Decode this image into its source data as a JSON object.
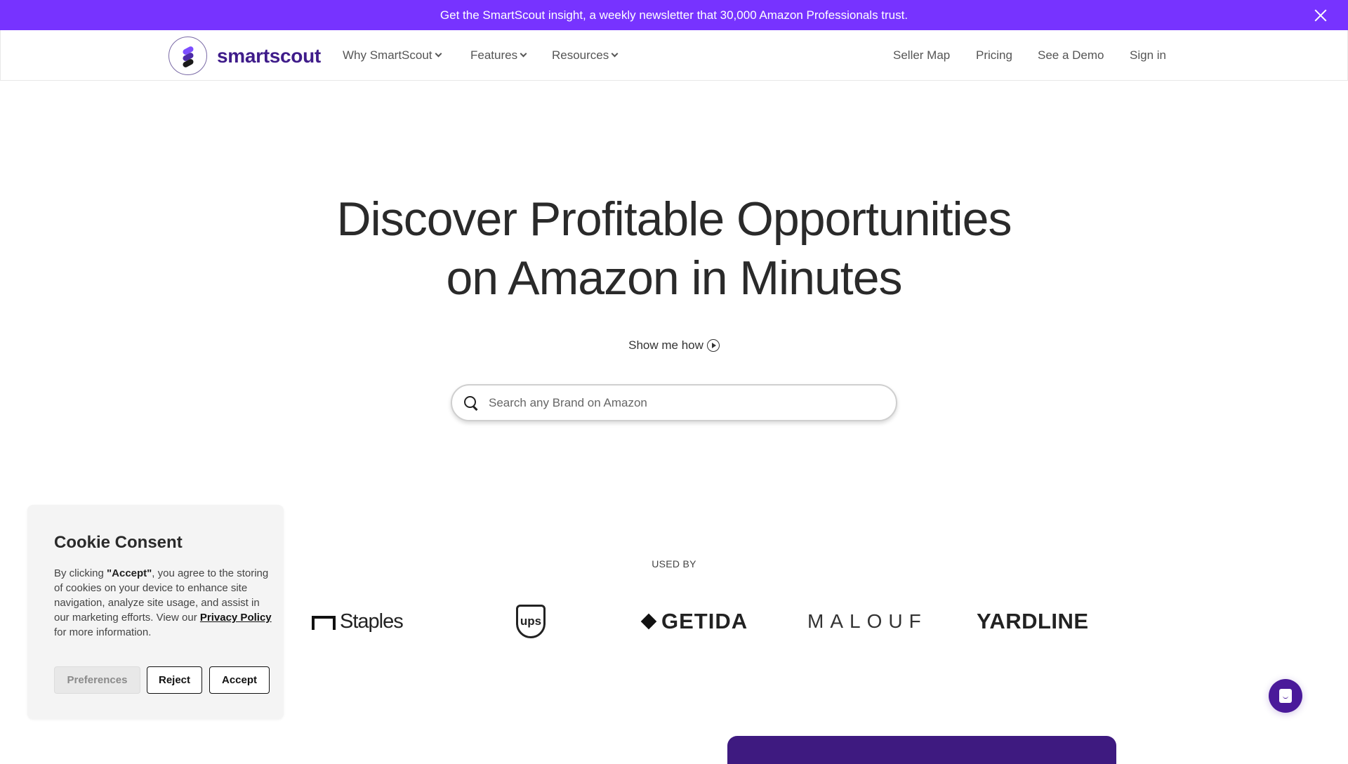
{
  "banner": {
    "text": "Get the SmartScout insight, a weekly newsletter that 30,000 Amazon Professionals trust.",
    "close_icon": "close-icon",
    "color": "#7733ff"
  },
  "nav": {
    "brand": "smartscout",
    "brand_color": "#3f1c8a",
    "left_links": [
      {
        "label": "Why SmartScout",
        "icon": "chevron-down-icon"
      },
      {
        "label": "Features",
        "icon": "chevron-down-icon"
      },
      {
        "label": "Resources",
        "icon": "chevron-down-icon"
      }
    ],
    "right_links": [
      {
        "label": "Seller Map"
      },
      {
        "label": "Pricing"
      },
      {
        "label": "See a Demo"
      },
      {
        "label": "Sign in"
      }
    ]
  },
  "hero": {
    "title_line1": "Discover Profitable Opportunities",
    "title_line2": "on Amazon in Minutes",
    "show_me_how": "Show me how",
    "search_placeholder": "Search any Brand on Amazon",
    "search_value": ""
  },
  "used_by": {
    "label": "USED BY",
    "brands": [
      "Staples",
      "ups",
      "GETIDA",
      "MALOUF",
      "YARDLINE"
    ]
  },
  "cookie": {
    "title": "Cookie Consent",
    "text_pre": "By clicking ",
    "text_bold": "\"Accept\"",
    "text_mid": ", you agree to the storing of cookies on your device to enhance site navigation, analyze site usage, and assist in our marketing efforts. View our ",
    "link": "Privacy Policy",
    "text_post": " for more information.",
    "buttons": {
      "preferences": "Preferences",
      "reject": "Reject",
      "accept": "Accept"
    }
  },
  "chat": {
    "icon": "chat-icon",
    "color": "#4a1a9a"
  }
}
